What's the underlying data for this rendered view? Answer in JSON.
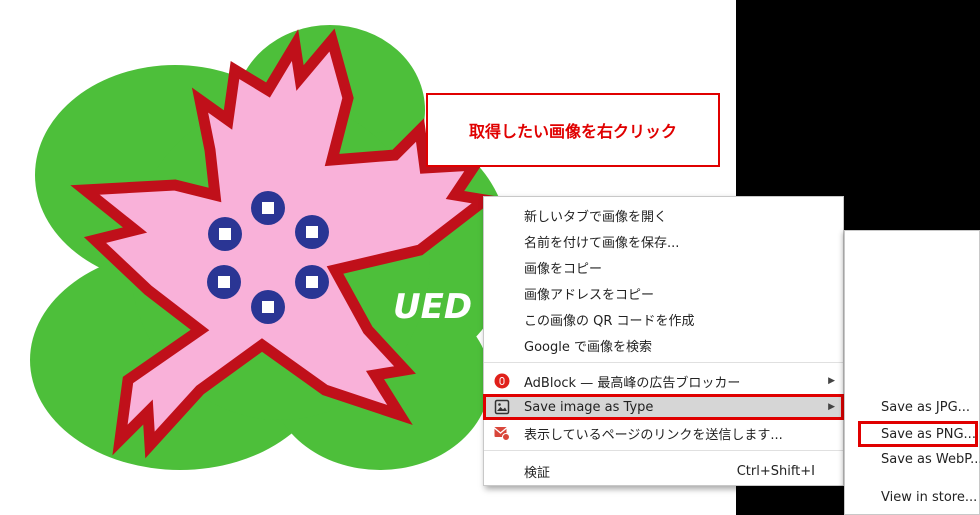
{
  "callout": {
    "text": "取得したい画像を右クリック"
  },
  "image": {
    "logo_text": "UED"
  },
  "context_menu": {
    "items": [
      {
        "label": "新しいタブで画像を開く"
      },
      {
        "label": "名前を付けて画像を保存..."
      },
      {
        "label": "画像をコピー"
      },
      {
        "label": "画像アドレスをコピー"
      },
      {
        "label": "この画像の QR コードを作成"
      },
      {
        "label": "Google で画像を検索"
      }
    ],
    "adblock": {
      "label": "AdBlock — 最高峰の広告ブロッカー"
    },
    "save_type": {
      "label": "Save image as Type"
    },
    "send_link": {
      "label": "表示しているページのリンクを送信します..."
    },
    "inspect": {
      "label": "検証",
      "shortcut": "Ctrl+Shift+I"
    }
  },
  "submenu": {
    "items": [
      {
        "label": "Save as JPG..."
      },
      {
        "label": "Save as PNG..."
      },
      {
        "label": "Save as WebP..."
      },
      {
        "label": "View in store..."
      }
    ]
  },
  "colors": {
    "highlight": "#e00000",
    "leaf": "#4dbf3a",
    "petal": "#f9b1d9",
    "petal_border": "#c0101a",
    "dot": "#2a3594"
  }
}
